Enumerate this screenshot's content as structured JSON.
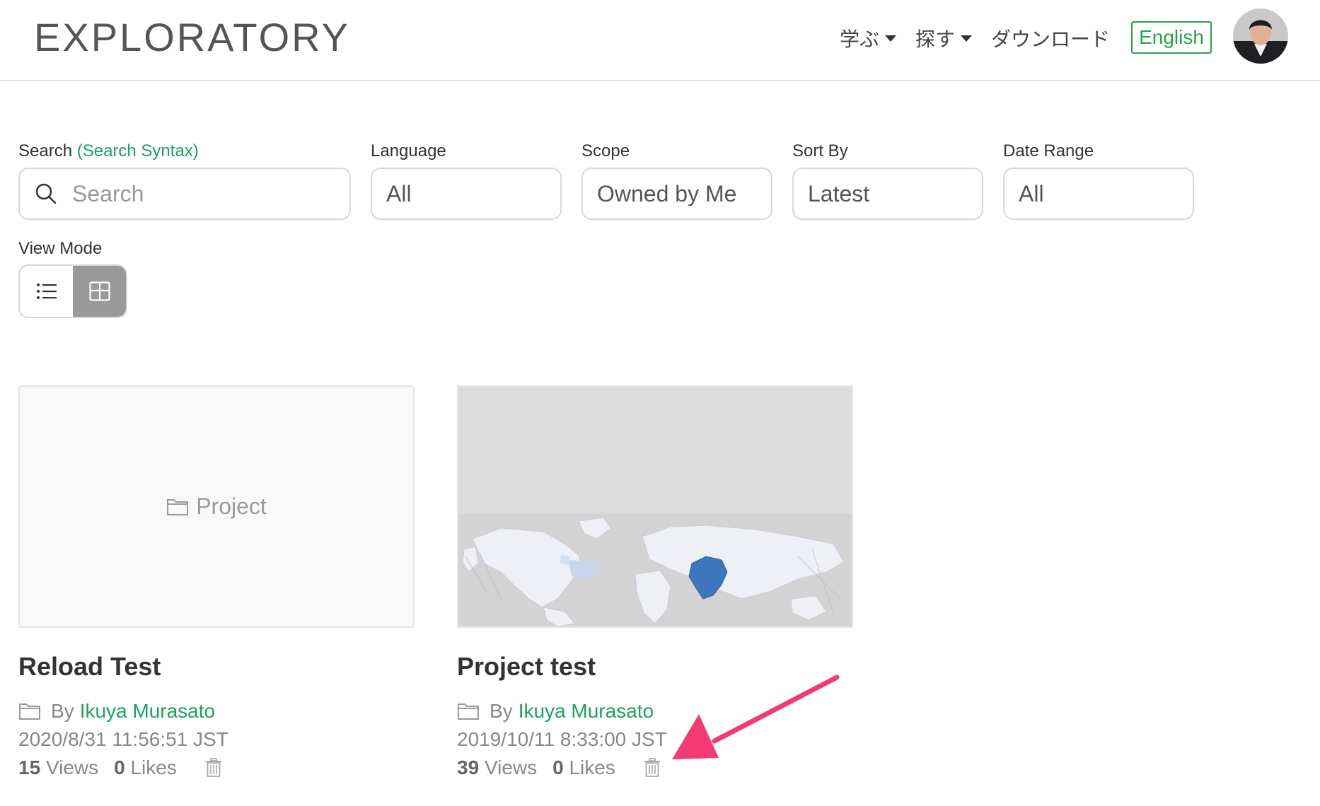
{
  "header": {
    "logo": "EXPLORATORY",
    "nav": [
      {
        "label": "学ぶ"
      },
      {
        "label": "探す"
      },
      {
        "label": "ダウンロード"
      }
    ],
    "language_button": "English"
  },
  "filters": {
    "search": {
      "label": "Search",
      "syntax_link": "(Search Syntax)",
      "placeholder": "Search"
    },
    "language": {
      "label": "Language",
      "value": "All"
    },
    "scope": {
      "label": "Scope",
      "value": "Owned by Me"
    },
    "sort_by": {
      "label": "Sort By",
      "value": "Latest"
    },
    "date_range": {
      "label": "Date Range",
      "value": "All"
    }
  },
  "view_mode": {
    "label": "View Mode",
    "selected": "grid"
  },
  "cards": [
    {
      "title": "Reload Test",
      "placeholder": "Project",
      "by": "By",
      "author": "Ikuya Murasato",
      "date": "2020/8/31 11:56:51 JST",
      "views_count": "15",
      "views_label": "Views",
      "likes_count": "0",
      "likes_label": "Likes"
    },
    {
      "title": "Project test",
      "by": "By",
      "author": "Ikuya Murasato",
      "date": "2019/10/11 8:33:00 JST",
      "views_count": "39",
      "views_label": "Views",
      "likes_count": "0",
      "likes_label": "Likes"
    }
  ],
  "colors": {
    "accent": "#1aa35a",
    "arrow": "#f23b73"
  }
}
